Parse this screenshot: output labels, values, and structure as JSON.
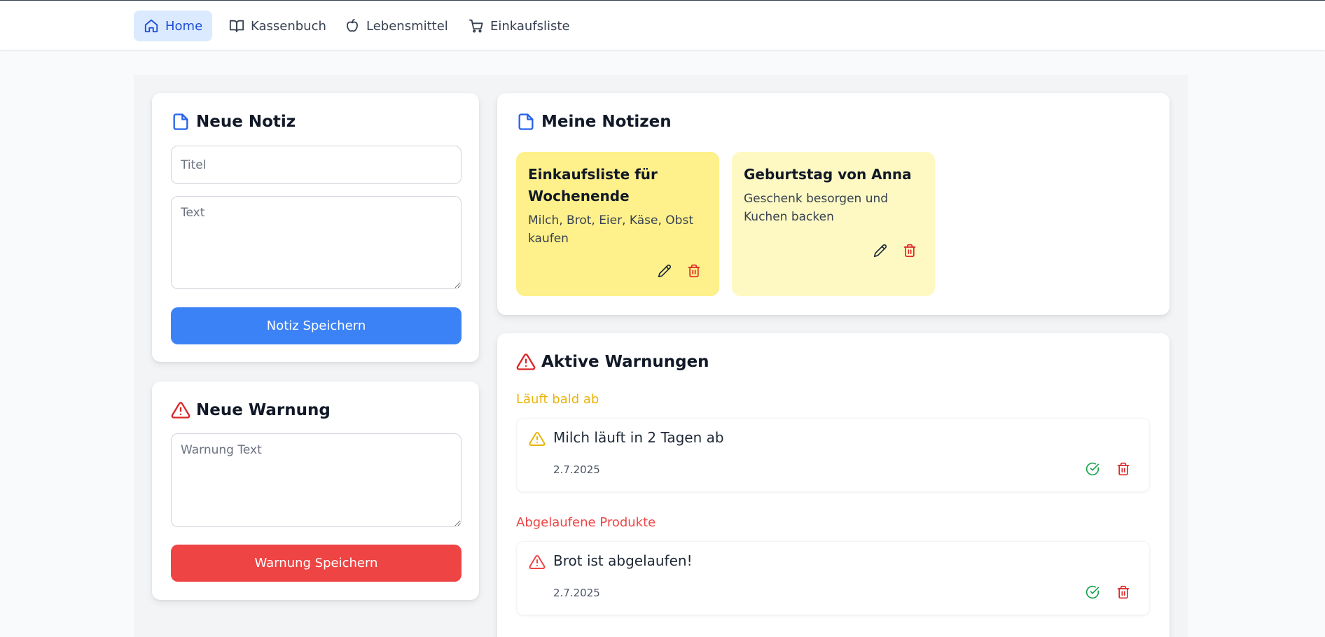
{
  "nav": {
    "items": [
      {
        "label": "Home",
        "icon": "home-icon",
        "active": true
      },
      {
        "label": "Kassenbuch",
        "icon": "book-icon",
        "active": false
      },
      {
        "label": "Lebensmittel",
        "icon": "apple-icon",
        "active": false
      },
      {
        "label": "Einkaufsliste",
        "icon": "cart-icon",
        "active": false
      }
    ]
  },
  "new_note": {
    "title": "Neue Notiz",
    "title_placeholder": "Titel",
    "text_placeholder": "Text",
    "save_label": "Notiz Speichern",
    "icon": "note-icon"
  },
  "new_warning": {
    "title": "Neue Warnung",
    "text_placeholder": "Warnung Text",
    "save_label": "Warnung Speichern",
    "icon": "alert-triangle-icon"
  },
  "my_notes": {
    "title": "Meine Notizen",
    "icon": "note-icon",
    "notes": [
      {
        "title": "Einkaufsliste für Wochenende",
        "text": "Milch, Brot, Eier, Käse, Obst kaufen",
        "color": "#fef08a"
      },
      {
        "title": "Geburtstag von Anna",
        "text": "Geschenk besorgen und Kuchen backen",
        "color": "#fef9c3"
      }
    ]
  },
  "active_warnings": {
    "title": "Aktive Warnungen",
    "icon": "alert-triangle-icon",
    "groups": [
      {
        "label": "Läuft bald ab",
        "color": "#eab308",
        "items": [
          {
            "text": "Milch läuft in 2 Tagen ab",
            "date": "2.7.2025"
          }
        ]
      },
      {
        "label": "Abgelaufene Produkte",
        "color": "#ef4444",
        "items": [
          {
            "text": "Brot ist abgelaufen!",
            "date": "2.7.2025"
          }
        ]
      }
    ]
  },
  "colors": {
    "primary": "#3b82f6",
    "danger": "#ef4444",
    "warning": "#eab308",
    "success": "#16a34a",
    "nav_active_bg": "#dbeafe"
  }
}
